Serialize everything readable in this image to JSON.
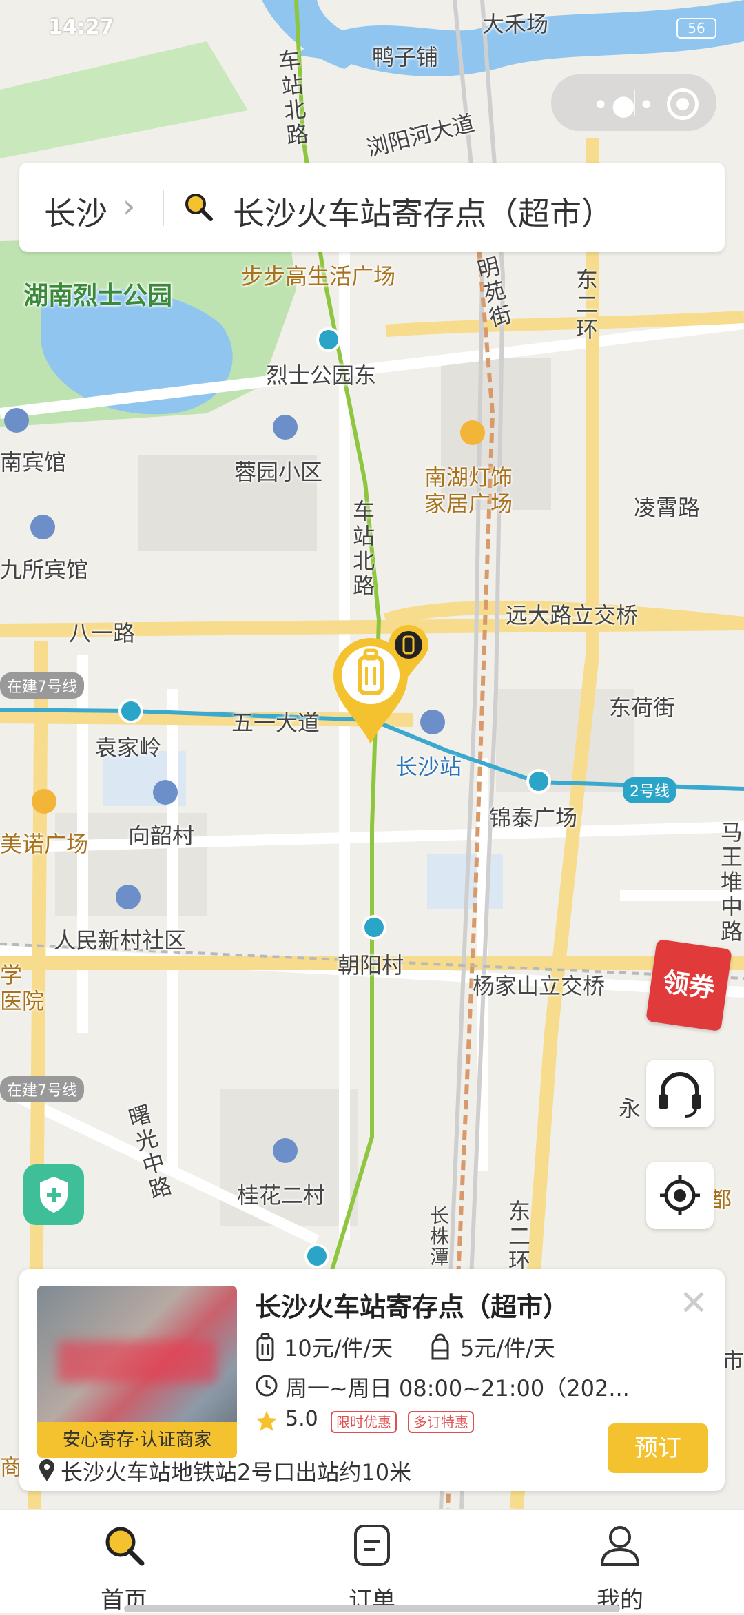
{
  "status_bar": {
    "time": "14:27",
    "battery": "56"
  },
  "map": {
    "labels": {
      "duck_shop": "鸭子铺",
      "da_he": "大禾场",
      "liuyang_river": "浏阳河大道",
      "station_north_top": "车站北路",
      "station_north_mid": "车站北路",
      "martyrs_park": "湖南烈士公园",
      "bubugao": "步步高生活广场",
      "mingyuan": "明苑街",
      "east_ring_top": "东二环",
      "martyrs_east": "烈士公园东",
      "nan_hotel": "南宾馆",
      "rongyuan": "蓉园小区",
      "nanhu": "南湖灯饰",
      "nanhu2": "家居广场",
      "lingxiao": "凌霄路",
      "jiusuo": "九所宾馆",
      "bayi": "八一路",
      "yuanda": "远大路立交桥",
      "line7a": "在建7号线",
      "line7b": "在建7号线",
      "wuyi": "五一大道",
      "donghe": "东荷街",
      "yuanjialing": "袁家岭",
      "changsha_station": "长沙站",
      "jintai": "锦泰广场",
      "line2": "2号线",
      "meinuo": "美诺广场",
      "xiangshao": "向韶村",
      "mawangdui": "马王堆中路",
      "renmin": "人民新村社区",
      "chaoyang": "朝阳村",
      "yangjiashan": "杨家山立交桥",
      "hospital1": "学",
      "hospital2": "医院",
      "shuguang": "曙光中路",
      "yong": "永",
      "guihua": "桂花二村",
      "changzhu": "长株潭",
      "east_ring_bottom": "东二环",
      "du": "都",
      "shang": "商",
      "shi": "市"
    }
  },
  "search": {
    "city": "长沙",
    "query": "长沙火车站寄存点（超市）"
  },
  "coupon": {
    "label": "领券"
  },
  "card": {
    "badge": "安心寄存·认证商家",
    "title": "长沙火车站寄存点（超市）",
    "price_luggage": "10元/件/天",
    "price_bag": "5元/件/天",
    "hours": "周一~周日 08:00~21:00（202...",
    "rating": "5.0",
    "tag1": "限时优惠",
    "tag2": "多订特惠",
    "address": "长沙火车站地铁站2号口出站约10米",
    "book": "预订"
  },
  "tabs": [
    {
      "label": "首页"
    },
    {
      "label": "订单"
    },
    {
      "label": "我的"
    }
  ],
  "colors": {
    "accent": "#f4c22f",
    "water": "#8fc5ef",
    "park": "#bfe3b0",
    "metro": "#2aa5c8"
  }
}
